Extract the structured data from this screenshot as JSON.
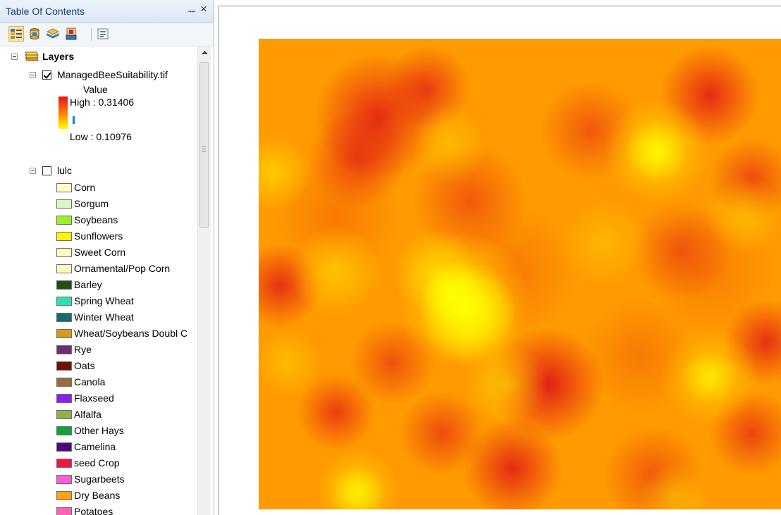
{
  "toc": {
    "title": "Table Of Contents",
    "pin_glyph": "ᅲ",
    "close_glyph": "×",
    "toolbar": [
      {
        "icon": "list-by-drawing-order-icon",
        "active": true
      },
      {
        "icon": "list-by-source-icon",
        "active": false
      },
      {
        "icon": "list-by-visibility-icon",
        "active": false
      },
      {
        "icon": "list-by-selection-icon",
        "active": false
      },
      {
        "icon": "options-icon",
        "active": false
      }
    ],
    "root_label": "Layers",
    "raster_layer": {
      "name": "ManagedBeeSuitability.tif",
      "checked": true,
      "field": "Value",
      "high_label": "High : 0.31406",
      "low_label": "Low : 0.10976",
      "ramp_colors": [
        "#e8121d",
        "#ff8c00",
        "#ffff00"
      ]
    },
    "vector_layer": {
      "name": "lulc",
      "checked": false,
      "classes": [
        {
          "label": "Corn",
          "color": "#ffffc8"
        },
        {
          "label": "Sorgum",
          "color": "#dcf5c3"
        },
        {
          "label": "Soybeans",
          "color": "#9bf02d"
        },
        {
          "label": "Sunflowers",
          "color": "#f7f500"
        },
        {
          "label": "Sweet Corn",
          "color": "#fffcc2"
        },
        {
          "label": "Ornamental/Pop Corn",
          "color": "#fff8c0"
        },
        {
          "label": "Barley",
          "color": "#1e5010"
        },
        {
          "label": "Spring Wheat",
          "color": "#2ee0b0"
        },
        {
          "label": "Winter Wheat",
          "color": "#176a6d"
        },
        {
          "label": "Wheat/Soybeans Doubl C",
          "color": "#d99b1f"
        },
        {
          "label": "Rye",
          "color": "#6e2f70"
        },
        {
          "label": "Oats",
          "color": "#6a1206"
        },
        {
          "label": "Canola",
          "color": "#9a6b3d"
        },
        {
          "label": "Flaxseed",
          "color": "#8b1ff0"
        },
        {
          "label": "Alfalfa",
          "color": "#8fb04a"
        },
        {
          "label": "Other Hays",
          "color": "#11a23a"
        },
        {
          "label": "Camelina",
          "color": "#4a0a7e"
        },
        {
          "label": "seed Crop",
          "color": "#f01449"
        },
        {
          "label": "Sugarbeets",
          "color": "#ff5bd9"
        },
        {
          "label": "Dry Beans",
          "color": "#ffa312"
        },
        {
          "label": "Potatoes",
          "color": "#ff63b8"
        }
      ]
    }
  },
  "map": {
    "low_color": "#ffff00",
    "mid_color": "#ff9a00",
    "high_color": "#e6161b"
  }
}
